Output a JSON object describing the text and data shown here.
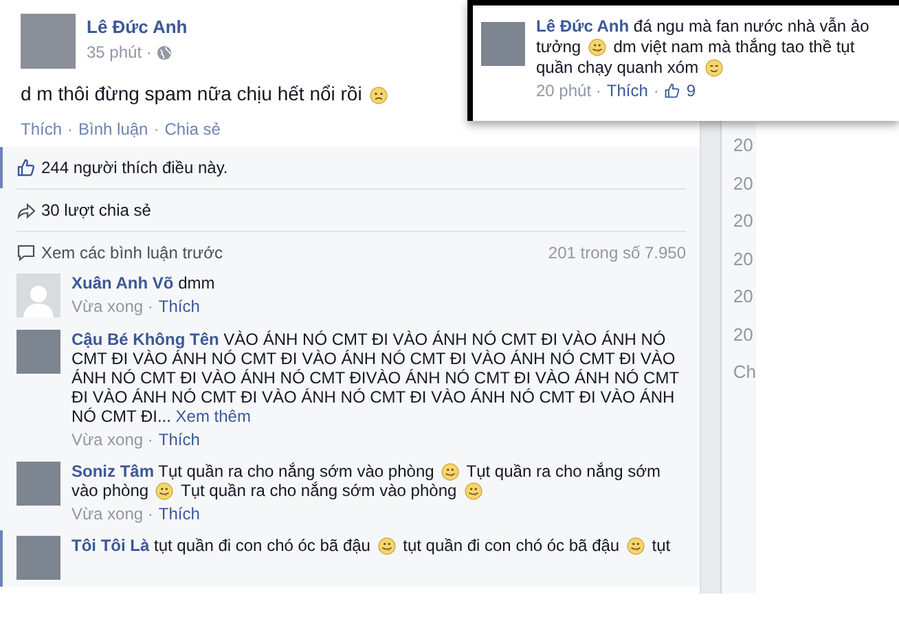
{
  "post": {
    "author": "Lê Đức Anh",
    "meta": [
      {
        "kind": "plain",
        "text": "35 phút ·"
      },
      {
        "kind": "globe"
      }
    ],
    "parts": [
      {
        "kind": "text",
        "text": "d m thôi đừng spam nữa chịu hết nổi rồi"
      },
      {
        "kind": "frown"
      }
    ],
    "actions": [
      {
        "kind": "action",
        "text": "Thích"
      },
      {
        "kind": "plain",
        "text": "·"
      },
      {
        "kind": "action",
        "text": "Bình luận"
      },
      {
        "kind": "plain",
        "text": "·"
      },
      {
        "kind": "action",
        "text": "Chia sẻ"
      }
    ]
  },
  "likes": {
    "text": "244 người thích điều này.",
    "highlighted": true
  },
  "shares": {
    "text": "30 lượt chia sẻ"
  },
  "previous_comments": {
    "text": "Xem các bình luận trước",
    "count": "201 trong số 7.950"
  },
  "comments": [
    {
      "author": "Xuân Anh Võ",
      "default_avatar": true,
      "highlighted": false,
      "parts": [
        {
          "kind": "text",
          "text": "dmm"
        }
      ],
      "meta": [
        {
          "kind": "plain",
          "text": "Vừa xong ·"
        },
        {
          "kind": "link",
          "text": "Thích"
        }
      ]
    },
    {
      "author": "Cậu Bé Không Tên",
      "default_avatar": false,
      "highlighted": false,
      "parts": [
        {
          "kind": "text",
          "text": "VÀO ÁNH NÓ CMT ĐI VÀO ÁNH NÓ CMT ĐI VÀO ÁNH NÓ CMT ĐI VÀO ÁNH NÓ CMT ĐI VÀO ÁNH NÓ CMT ĐI VÀO ÁNH NÓ CMT ĐI VÀO ÁNH NÓ CMT ĐI VÀO ÁNH NÓ CMT ĐIVÀO ÁNH NÓ CMT ĐI VÀO ÁNH NÓ CMT ĐI VÀO ÁNH NÓ CMT ĐI VÀO ÁNH NÓ CMT ĐI VÀO ÁNH NÓ CMT ĐI VÀO ÁNH NÓ CMT ĐI..."
        },
        {
          "kind": "more",
          "text": "Xem thêm"
        }
      ],
      "meta": [
        {
          "kind": "plain",
          "text": "Vừa xong ·"
        },
        {
          "kind": "link",
          "text": "Thích"
        }
      ]
    },
    {
      "author": "Soniz Tâm",
      "default_avatar": false,
      "highlighted": false,
      "parts": [
        {
          "kind": "text",
          "text": "Tụt quần ra cho nắng sớm vào phòng"
        },
        {
          "kind": "tongue"
        },
        {
          "kind": "text",
          "text": "Tụt quần ra cho nắng sớm vào phòng"
        },
        {
          "kind": "tongue"
        },
        {
          "kind": "text",
          "text": "Tụt quần ra cho nắng sớm vào phòng"
        },
        {
          "kind": "tongue"
        }
      ],
      "meta": [
        {
          "kind": "plain",
          "text": "Vừa xong ·"
        },
        {
          "kind": "link",
          "text": "Thích"
        }
      ]
    },
    {
      "author": "Tôi Tôi Là",
      "default_avatar": false,
      "highlighted": true,
      "parts": [
        {
          "kind": "text",
          "text": "tụt quần đi con chó óc bã đậu"
        },
        {
          "kind": "tongue"
        },
        {
          "kind": "text",
          "text": "tụt quần đi con chó óc bã đậu"
        },
        {
          "kind": "tongue"
        },
        {
          "kind": "text",
          "text": "tụt"
        }
      ]
    }
  ],
  "side_items": [
    "20",
    "20",
    "20",
    "20",
    "20",
    "20",
    "Ch"
  ],
  "popup": {
    "author": "Lê Đức Anh",
    "parts": [
      {
        "kind": "text",
        "text": "đá ngu mà fan nước nhà vẫn ảo tưởng"
      },
      {
        "kind": "tongue"
      },
      {
        "kind": "text",
        "text": "dm việt nam mà thắng tao thề tụt quần chạy quanh xóm"
      },
      {
        "kind": "smile"
      }
    ],
    "meta": [
      {
        "kind": "plain",
        "text": "20 phút ·"
      },
      {
        "kind": "link",
        "text": "Thích"
      },
      {
        "kind": "plain",
        "text": "·"
      },
      {
        "kind": "like"
      },
      {
        "kind": "link",
        "text": "9"
      }
    ]
  }
}
